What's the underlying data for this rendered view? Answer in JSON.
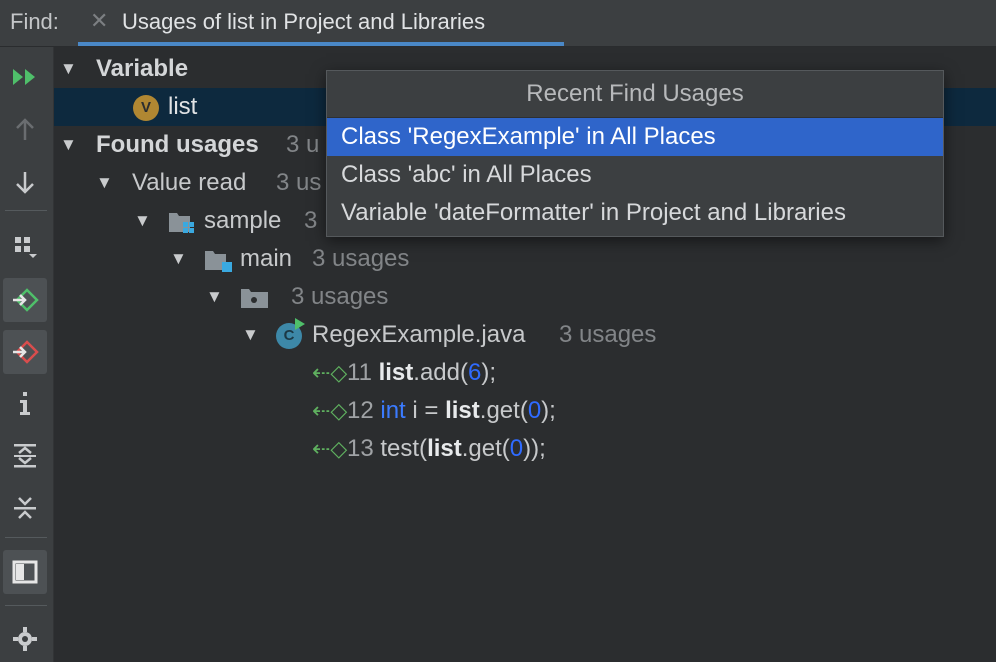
{
  "header": {
    "find_label": "Find:",
    "tab_title": "Usages of list in Project and Libraries"
  },
  "tree": {
    "variable_group": "Variable",
    "variable_icon_letter": "V",
    "variable_name": "list",
    "found_usages": "Found usages",
    "found_usages_count": "3 u",
    "value_read": "Value read",
    "value_read_count": "3 us",
    "module": "sample",
    "module_count": "3",
    "source_root": "main",
    "source_root_count": "3 usages",
    "package_count": "3 usages",
    "file_icon_letter": "C",
    "file": "RegexExample.java",
    "file_count": "3 usages",
    "lines": [
      {
        "num": "11",
        "a": "list",
        "b": ".add(",
        "c": "6",
        "d": ");"
      },
      {
        "num": "12",
        "kw": "int",
        "pre": " i = ",
        "a": "list",
        "b": ".get(",
        "c": "0",
        "d": ");"
      },
      {
        "num": "13",
        "pre": "test(",
        "a": "list",
        "b": ".get(",
        "c": "0",
        "d": "));"
      }
    ]
  },
  "popup": {
    "title": "Recent Find Usages",
    "items": [
      "Class 'RegexExample' in All Places",
      "Class 'abc' in All Places",
      "Variable 'dateFormatter' in Project and Libraries"
    ]
  },
  "colors": {
    "accent": "#4a88c7",
    "selection": "#2f65ca",
    "keyword": "#3b7bff"
  }
}
